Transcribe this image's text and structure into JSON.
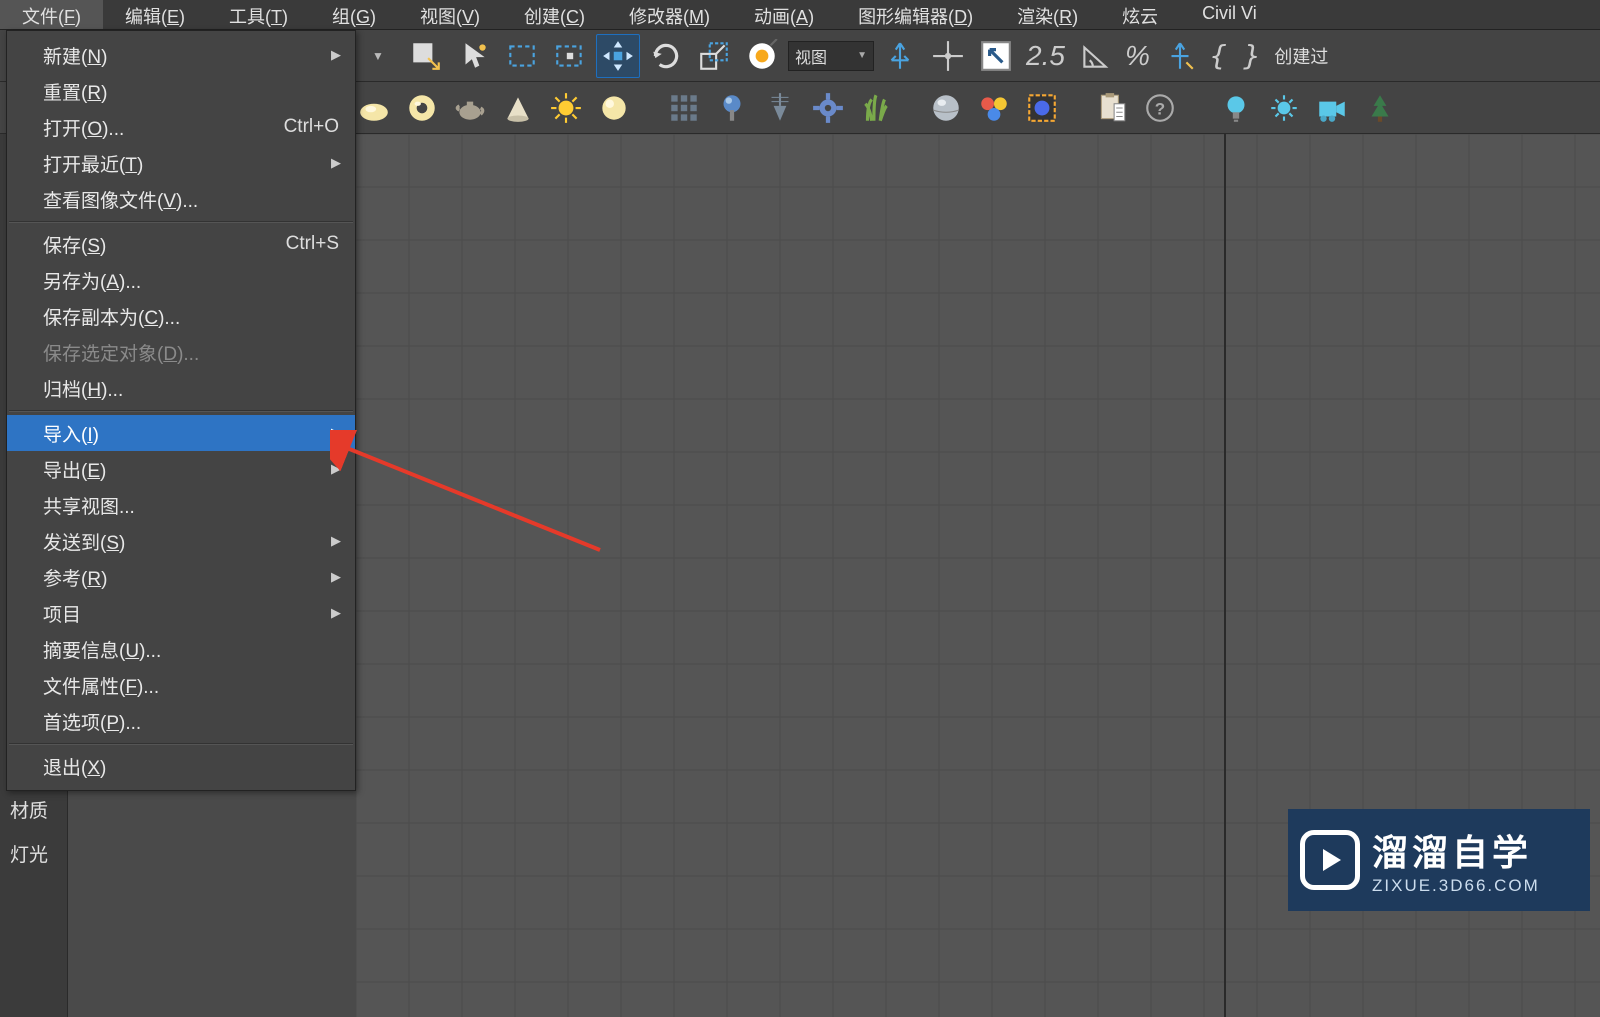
{
  "menubar": [
    {
      "pre": "文件(",
      "u": "F",
      "post": ")",
      "active": true
    },
    {
      "pre": "编辑(",
      "u": "E",
      "post": ")"
    },
    {
      "pre": "工具(",
      "u": "T",
      "post": ")"
    },
    {
      "pre": "组(",
      "u": "G",
      "post": ")"
    },
    {
      "pre": "视图(",
      "u": "V",
      "post": ")"
    },
    {
      "pre": "创建(",
      "u": "C",
      "post": ")"
    },
    {
      "pre": "修改器(",
      "u": "M",
      "post": ")"
    },
    {
      "pre": "动画(",
      "u": "A",
      "post": ")"
    },
    {
      "pre": "图形编辑器(",
      "u": "D",
      "post": ")"
    },
    {
      "pre": "渲染(",
      "u": "R",
      "post": ")"
    },
    {
      "pre": "炫云",
      "u": "",
      "post": ""
    },
    {
      "pre": "Civil Vi",
      "u": "",
      "post": ""
    }
  ],
  "file_menu": [
    {
      "pre": "新建(",
      "u": "N",
      "post": ")",
      "sub": true
    },
    {
      "pre": "重置(",
      "u": "R",
      "post": ")"
    },
    {
      "pre": "打开(",
      "u": "O",
      "post": ")...",
      "shortcut": "Ctrl+O"
    },
    {
      "pre": "打开最近(",
      "u": "T",
      "post": ")",
      "sub": true
    },
    {
      "pre": "查看图像文件(",
      "u": "V",
      "post": ")..."
    },
    {
      "sep": true
    },
    {
      "pre": "保存(",
      "u": "S",
      "post": ")",
      "shortcut": "Ctrl+S"
    },
    {
      "pre": "另存为(",
      "u": "A",
      "post": ")..."
    },
    {
      "pre": "保存副本为(",
      "u": "C",
      "post": ")..."
    },
    {
      "pre": "保存选定对象(",
      "u": "D",
      "post": ")...",
      "disabled": true
    },
    {
      "pre": "归档(",
      "u": "H",
      "post": ")..."
    },
    {
      "sep": true
    },
    {
      "pre": "导入(",
      "u": "I",
      "post": ")",
      "sub": true,
      "highlight": true
    },
    {
      "pre": "导出(",
      "u": "E",
      "post": ")",
      "sub": true
    },
    {
      "pre": "共享视图...",
      "u": "",
      "post": ""
    },
    {
      "pre": "发送到(",
      "u": "S",
      "post": ")",
      "sub": true
    },
    {
      "pre": "参考(",
      "u": "R",
      "post": ")",
      "sub": true
    },
    {
      "pre": "项目",
      "u": "",
      "post": "",
      "sub": true
    },
    {
      "pre": "摘要信息(",
      "u": "U",
      "post": ")..."
    },
    {
      "pre": "文件属性(",
      "u": "F",
      "post": ")..."
    },
    {
      "pre": "首选项(",
      "u": "P",
      "post": ")..."
    },
    {
      "sep": true
    },
    {
      "pre": "退出(",
      "u": "X",
      "post": ")"
    }
  ],
  "toolbar1": {
    "dropdown_label": "视图",
    "angle_text": "2.5",
    "percent_text": "%",
    "curly_text": "{ }",
    "create_text": "创建过"
  },
  "left_labels": {
    "mat": "材质",
    "light": "灯光"
  },
  "watermark": {
    "big": "溜溜自学",
    "small": "ZIXUE.3D66.COM"
  }
}
